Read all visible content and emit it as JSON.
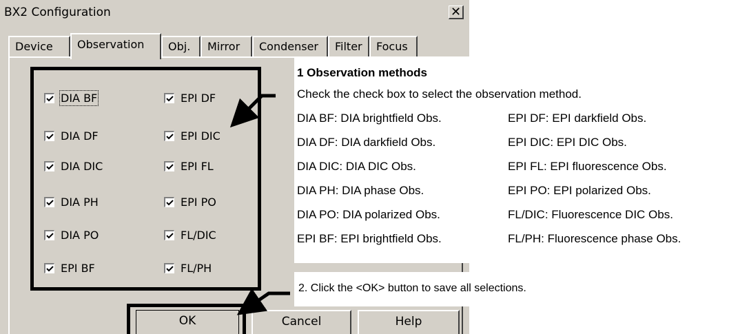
{
  "window": {
    "title": "BX2 Configuration",
    "close_glyph": "✕"
  },
  "tabs": [
    {
      "label": "Device"
    },
    {
      "label": "Observation"
    },
    {
      "label": "Obj."
    },
    {
      "label": "Mirror"
    },
    {
      "label": "Condenser"
    },
    {
      "label": "Filter"
    },
    {
      "label": "Focus"
    }
  ],
  "checkboxes": {
    "left": [
      {
        "label": "DIA BF",
        "checked": true
      },
      {
        "label": "DIA DF",
        "checked": true
      },
      {
        "label": "DIA DIC",
        "checked": true
      },
      {
        "label": "DIA PH",
        "checked": true
      },
      {
        "label": "DIA PO",
        "checked": true
      },
      {
        "label": "EPI BF",
        "checked": true
      }
    ],
    "right": [
      {
        "label": "EPI DF",
        "checked": true
      },
      {
        "label": "EPI DIC",
        "checked": true
      },
      {
        "label": "EPI FL",
        "checked": true
      },
      {
        "label": "EPI PO",
        "checked": true
      },
      {
        "label": "FL/DIC",
        "checked": true
      },
      {
        "label": "FL/PH",
        "checked": true
      }
    ]
  },
  "buttons": {
    "ok": "OK",
    "cancel": "Cancel",
    "help": "Help"
  },
  "annotation1": {
    "heading": "1  Observation methods",
    "intro": "Check the check box to select the observation method.",
    "rows": [
      [
        "DIA BF: DIA brightfield Obs.",
        "EPI DF: EPI darkfield Obs."
      ],
      [
        "DIA DF: DIA darkfield Obs.",
        "EPI DIC: EPI DIC Obs."
      ],
      [
        "DIA DIC: DIA DIC Obs.",
        "EPI FL: EPI fluorescence Obs."
      ],
      [
        "DIA PH: DIA phase Obs.",
        "EPI PO: EPI polarized Obs."
      ],
      [
        "DIA PO: DIA polarized Obs.",
        "FL/DIC: Fluorescence DIC Obs."
      ],
      [
        "EPI BF: EPI brightfield Obs.",
        "FL/PH: Fluorescence phase Obs."
      ]
    ]
  },
  "annotation2": {
    "text": "2.  Click the <OK> button to save all selections."
  }
}
